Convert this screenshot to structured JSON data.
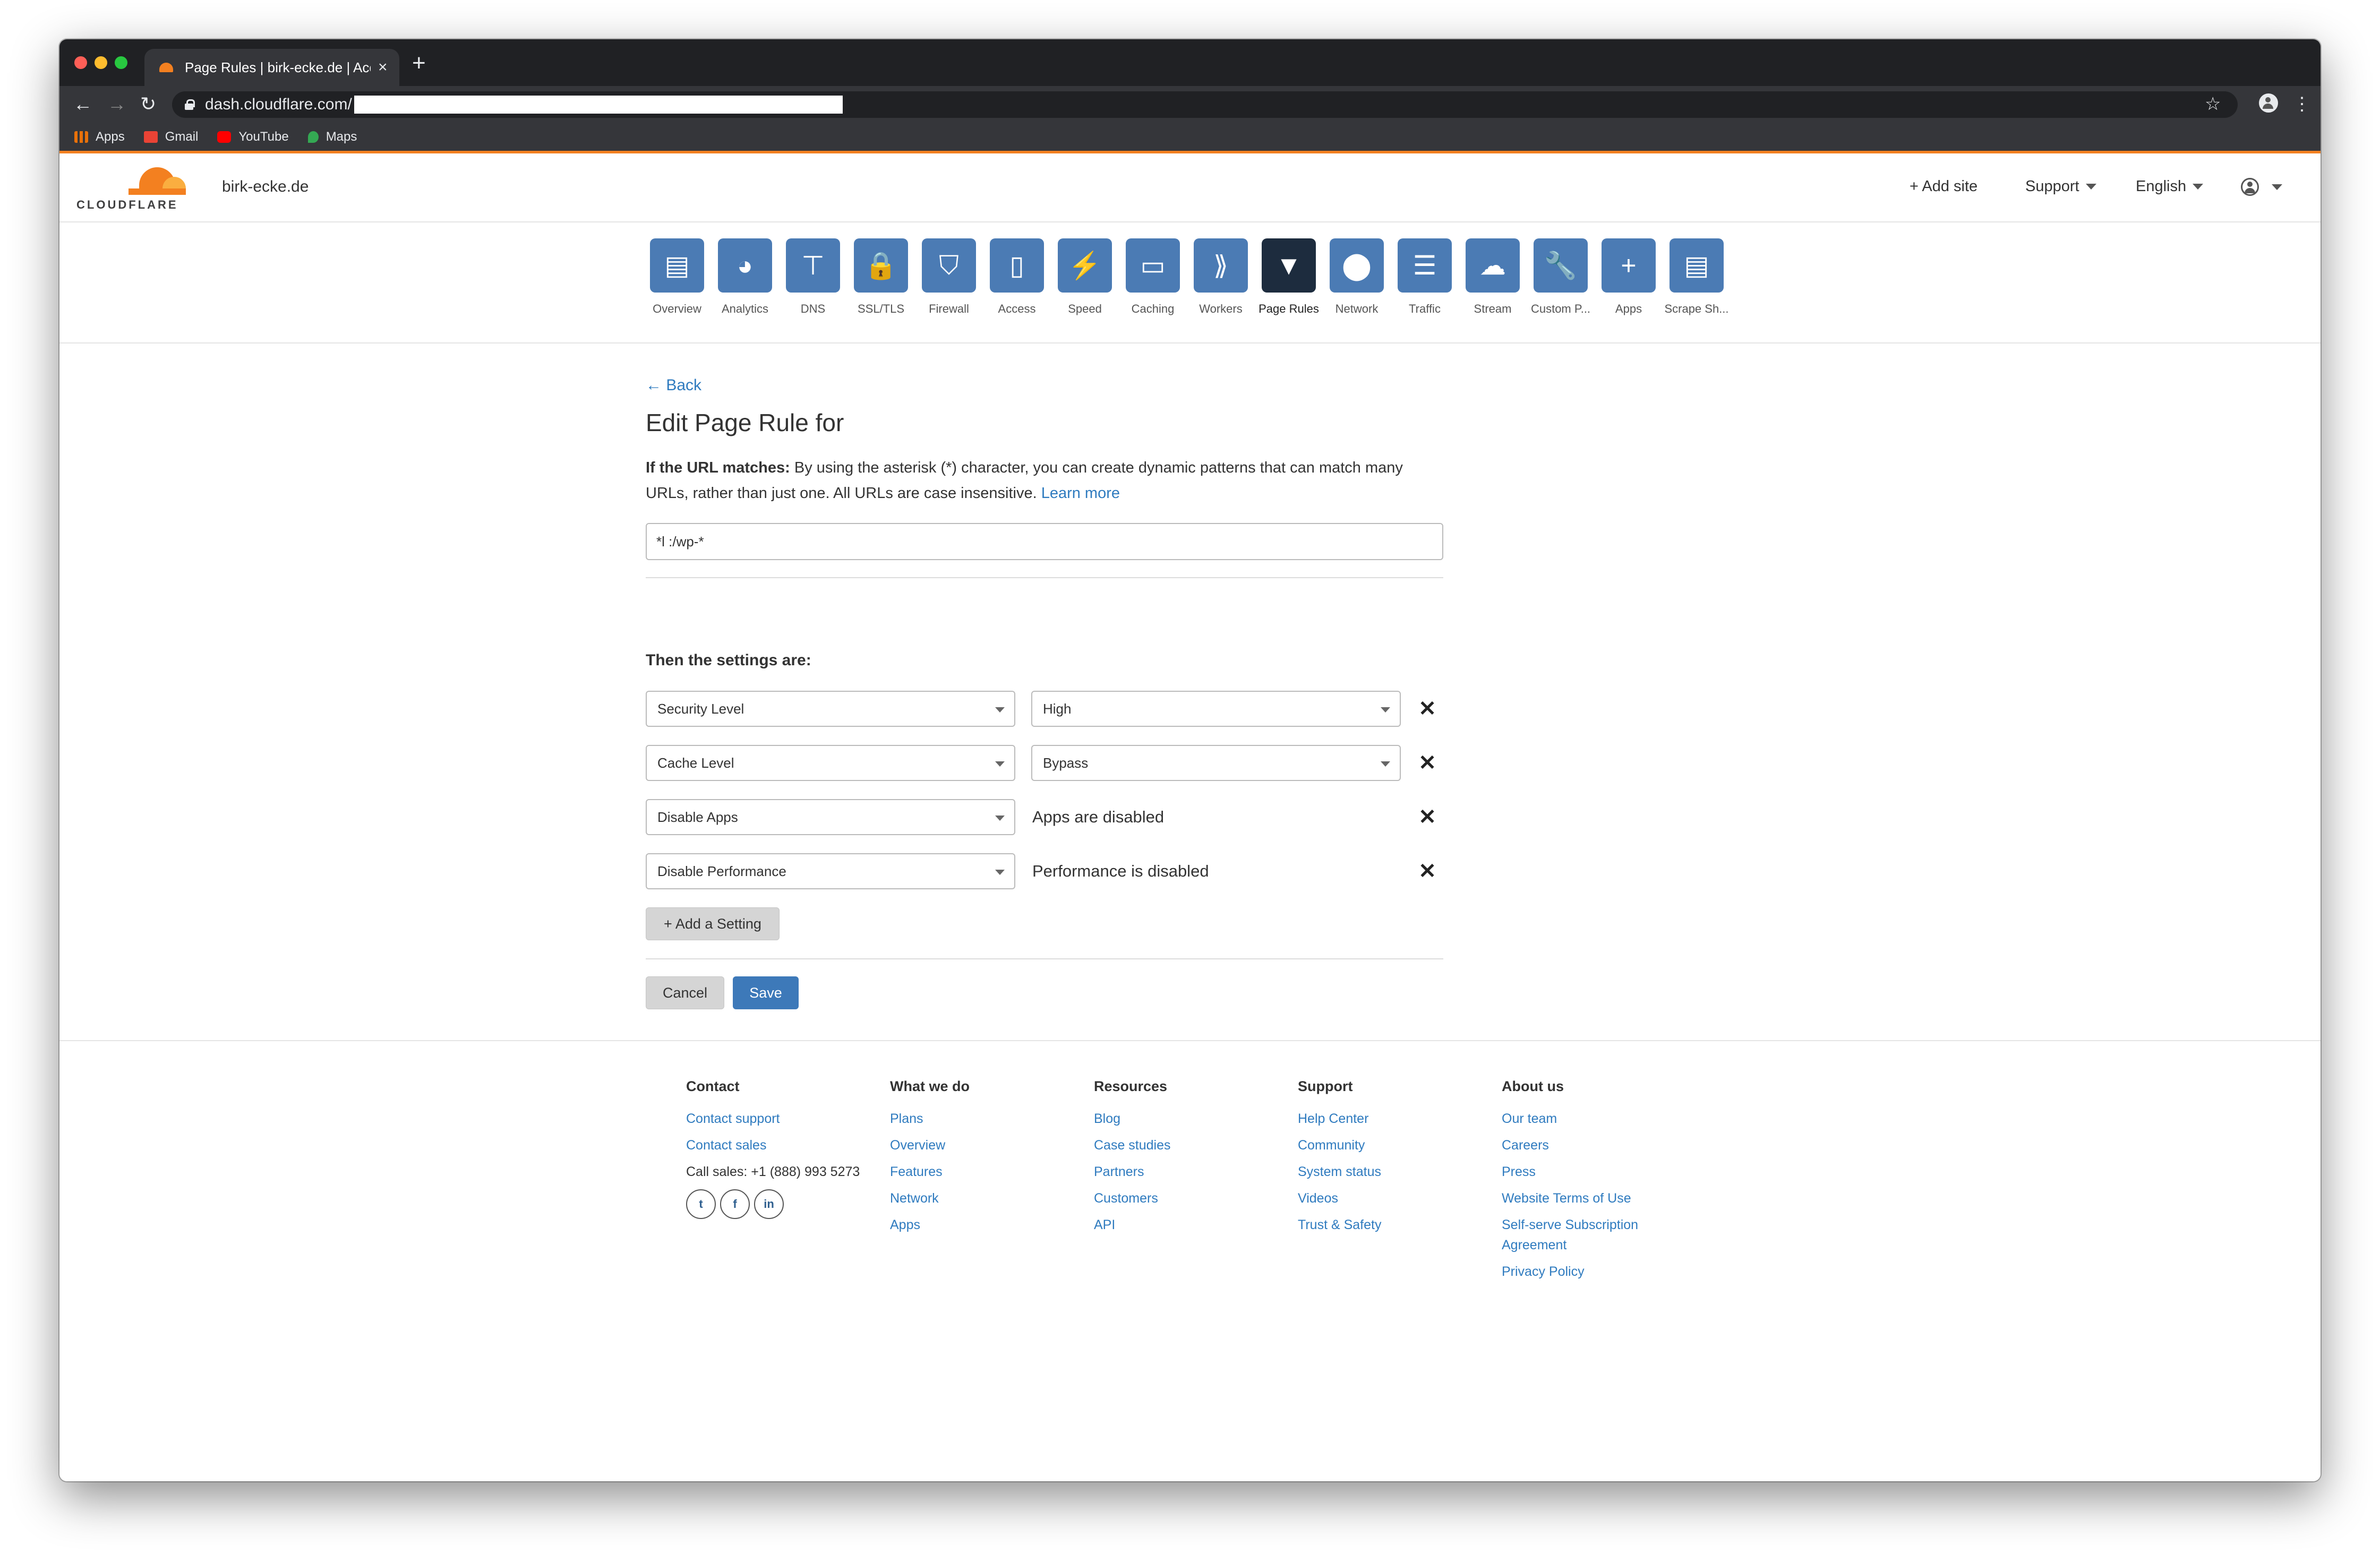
{
  "browser": {
    "tab_title": "Page Rules | birk-ecke.de | Acco",
    "tab_close": "×",
    "new_tab": "+",
    "url": "dash.cloudflare.com/",
    "back": "←",
    "forward": "→",
    "reload": "↻",
    "star": "☆",
    "menu": "⋮",
    "bookmarks": [
      {
        "label": "Apps",
        "icon": "apps-grid-icon",
        "color": "#e8710a"
      },
      {
        "label": "Gmail",
        "icon": "gmail-icon",
        "color": "#ea4335"
      },
      {
        "label": "YouTube",
        "icon": "youtube-icon",
        "color": "#ff0000"
      },
      {
        "label": "Maps",
        "icon": "maps-icon",
        "color": "#34a853"
      }
    ]
  },
  "header": {
    "logo_text": "CLOUDFLARE",
    "site_name": "birk-ecke.de",
    "add_site": "+ Add site",
    "support": "Support",
    "language": "English"
  },
  "nav": [
    {
      "label": "Overview",
      "icon": "overview-icon",
      "glyph": "▤"
    },
    {
      "label": "Analytics",
      "icon": "analytics-icon",
      "glyph": "◕"
    },
    {
      "label": "DNS",
      "icon": "dns-icon",
      "glyph": "⊤"
    },
    {
      "label": "SSL/TLS",
      "icon": "lock-icon",
      "glyph": "🔒"
    },
    {
      "label": "Firewall",
      "icon": "shield-icon",
      "glyph": "⛉"
    },
    {
      "label": "Access",
      "icon": "door-icon",
      "glyph": "▯"
    },
    {
      "label": "Speed",
      "icon": "bolt-icon",
      "glyph": "⚡"
    },
    {
      "label": "Caching",
      "icon": "server-icon",
      "glyph": "▭"
    },
    {
      "label": "Workers",
      "icon": "workers-icon",
      "glyph": "⟫"
    },
    {
      "label": "Page Rules",
      "icon": "filter-icon",
      "glyph": "▼",
      "active": true
    },
    {
      "label": "Network",
      "icon": "pin-icon",
      "glyph": "⬤"
    },
    {
      "label": "Traffic",
      "icon": "list-icon",
      "glyph": "☰"
    },
    {
      "label": "Stream",
      "icon": "cloud-play-icon",
      "glyph": "☁"
    },
    {
      "label": "Custom P...",
      "icon": "wrench-icon",
      "glyph": "🔧"
    },
    {
      "label": "Apps",
      "icon": "plus-icon",
      "glyph": "+"
    },
    {
      "label": "Scrape Sh...",
      "icon": "document-icon",
      "glyph": "▤"
    }
  ],
  "main": {
    "back": "← Back",
    "title": "Edit Page Rule for",
    "desc_bold": "If the URL matches:",
    "desc_text": " By using the asterisk (*) character, you can create dynamic patterns that can match many URLs, rather than just one. All URLs are case insensitive. ",
    "learn_more": "Learn more",
    "url_value": "*l                  :/wp-*",
    "settings_heading": "Then the settings are:",
    "settings": [
      {
        "setting": "Security Level",
        "value": "High",
        "value_type": "select"
      },
      {
        "setting": "Cache Level",
        "value": "Bypass",
        "value_type": "select"
      },
      {
        "setting": "Disable Apps",
        "value": "Apps are disabled",
        "value_type": "text"
      },
      {
        "setting": "Disable Performance",
        "value": "Performance is disabled",
        "value_type": "text"
      }
    ],
    "remove_glyph": "✕",
    "add_setting": "+ Add a Setting",
    "cancel": "Cancel",
    "save": "Save"
  },
  "footer": {
    "columns": [
      {
        "heading": "Contact",
        "links": [
          "Contact support",
          "Contact sales"
        ],
        "text": "Call sales: +1 (888) 993 5273",
        "social": [
          "t",
          "f",
          "in"
        ]
      },
      {
        "heading": "What we do",
        "links": [
          "Plans",
          "Overview",
          "Features",
          "Network",
          "Apps"
        ]
      },
      {
        "heading": "Resources",
        "links": [
          "Blog",
          "Case studies",
          "Partners",
          "Customers",
          "API"
        ]
      },
      {
        "heading": "Support",
        "links": [
          "Help Center",
          "Community",
          "System status",
          "Videos",
          "Trust & Safety"
        ]
      },
      {
        "heading": "About us",
        "links": [
          "Our team",
          "Careers",
          "Press",
          "Website Terms of Use",
          "Self-serve Subscription Agreement",
          "Privacy Policy"
        ]
      }
    ]
  }
}
